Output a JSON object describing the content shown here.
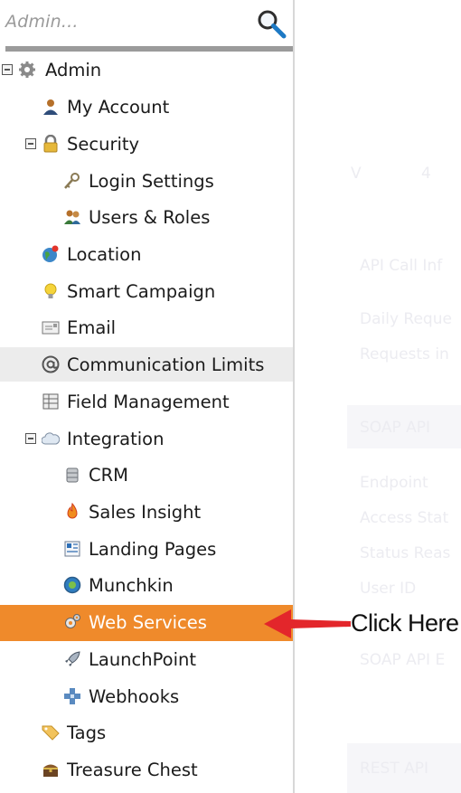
{
  "search": {
    "placeholder": "Admin..."
  },
  "tree": [
    {
      "id": "admin",
      "label": "Admin",
      "icon": "gear-icon",
      "toggle": true
    },
    {
      "id": "my-account",
      "label": "My Account",
      "icon": "user-icon"
    },
    {
      "id": "security",
      "label": "Security",
      "icon": "lock-icon",
      "toggle": true
    },
    {
      "id": "login-settings",
      "label": "Login Settings",
      "icon": "keys-icon"
    },
    {
      "id": "users-roles",
      "label": "Users & Roles",
      "icon": "users-icon"
    },
    {
      "id": "location",
      "label": "Location",
      "icon": "globe-icon"
    },
    {
      "id": "smart-campaign",
      "label": "Smart Campaign",
      "icon": "lightbulb-icon"
    },
    {
      "id": "email",
      "label": "Email",
      "icon": "email-icon"
    },
    {
      "id": "communication-limits",
      "label": "Communication Limits",
      "icon": "at-sign-icon",
      "state": "hover"
    },
    {
      "id": "field-management",
      "label": "Field Management",
      "icon": "field-grid-icon"
    },
    {
      "id": "integration",
      "label": "Integration",
      "icon": "cloud-icon",
      "toggle": true
    },
    {
      "id": "crm",
      "label": "CRM",
      "icon": "database-icon"
    },
    {
      "id": "sales-insight",
      "label": "Sales Insight",
      "icon": "flame-icon"
    },
    {
      "id": "landing-pages",
      "label": "Landing Pages",
      "icon": "page-layout-icon"
    },
    {
      "id": "munchkin",
      "label": "Munchkin",
      "icon": "munchkin-globe-icon"
    },
    {
      "id": "web-services",
      "label": "Web Services",
      "icon": "gears-icon",
      "state": "selected"
    },
    {
      "id": "launchpoint",
      "label": "LaunchPoint",
      "icon": "rocket-icon"
    },
    {
      "id": "webhooks",
      "label": "Webhooks",
      "icon": "webhook-icon"
    },
    {
      "id": "tags",
      "label": "Tags",
      "icon": "tag-icon"
    },
    {
      "id": "treasure-chest",
      "label": "Treasure Chest",
      "icon": "treasure-chest-icon"
    }
  ],
  "main": {
    "faded_labels": [
      "V",
      "4",
      "API Call Inf",
      "Daily Reque",
      "Requests in",
      "SOAP API",
      "Endpoint",
      "Access Stat",
      "Status Reas",
      "User ID",
      "SOAP API E",
      "REST API"
    ]
  },
  "annotation": {
    "label": "Click Here",
    "arrow_color": "#e3262b"
  },
  "colors": {
    "selected_bg": "#ef8a2b",
    "hover_bg": "#ececec",
    "search_rule": "#9b9b9b"
  }
}
